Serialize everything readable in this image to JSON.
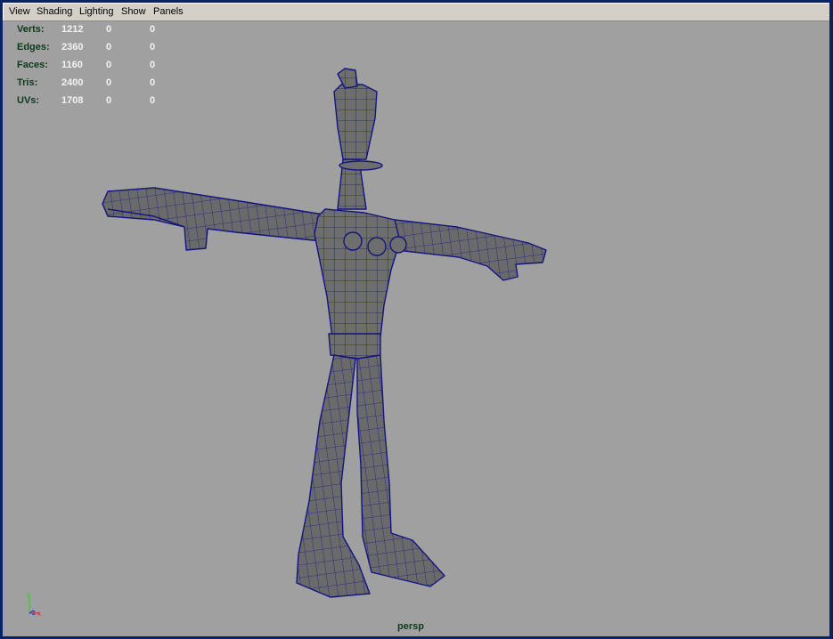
{
  "menu": [
    "View",
    "Shading",
    "Lighting",
    "Show",
    "Panels"
  ],
  "hud": {
    "rows": [
      {
        "label": "Verts:",
        "values": [
          "1212",
          "0",
          "0"
        ]
      },
      {
        "label": "Edges:",
        "values": [
          "2360",
          "0",
          "0"
        ]
      },
      {
        "label": "Faces:",
        "values": [
          "1160",
          "0",
          "0"
        ]
      },
      {
        "label": "Tris:",
        "values": [
          "2400",
          "0",
          "0"
        ]
      },
      {
        "label": "UVs:",
        "values": [
          "1708",
          "0",
          "0"
        ]
      }
    ]
  },
  "camera_label": "persp",
  "axis": {
    "y": "y",
    "z": "z",
    "x": "x"
  },
  "colors": {
    "viewport_bg": "#a0a0a0",
    "wire": "#1a1a8c",
    "mesh_fill": "#6e6e6e",
    "hud_label": "#0d3b1a"
  }
}
